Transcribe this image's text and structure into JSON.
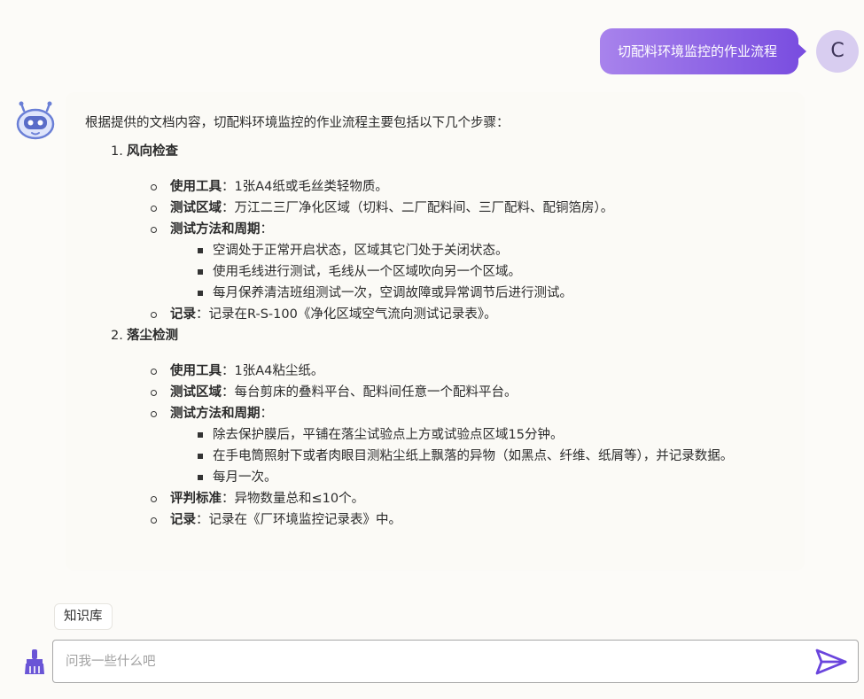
{
  "user_message": {
    "text": "切配料环境监控的作业流程",
    "avatar_letter": "C"
  },
  "bot_message": {
    "intro": "根据提供的文档内容，切配料环境监控的作业流程主要包括以下几个步骤：",
    "steps": [
      {
        "num": "1.",
        "title": "风向检查",
        "items": [
          {
            "key": "使用工具",
            "sep": "：",
            "value": "1张A4纸或毛丝类轻物质。"
          },
          {
            "key": "测试区域",
            "sep": "：",
            "value": "万江二三厂净化区域（切料、二厂配料间、三厂配料、配铜箔房）。"
          },
          {
            "key": "测试方法和周期",
            "sep": "：",
            "value": "",
            "subs": [
              "空调处于正常开启状态，区域其它门处于关闭状态。",
              "使用毛线进行测试，毛线从一个区域吹向另一个区域。",
              "每月保养清洁班组测试一次，空调故障或异常调节后进行测试。"
            ]
          },
          {
            "key": "记录",
            "sep": "：",
            "value": "记录在R-S-100《净化区域空气流向测试记录表》。"
          }
        ]
      },
      {
        "num": "2.",
        "title": "落尘检测",
        "items": [
          {
            "key": "使用工具",
            "sep": "：",
            "value": "1张A4粘尘纸。"
          },
          {
            "key": "测试区域",
            "sep": "：",
            "value": "每台剪床的叠料平台、配料间任意一个配料平台。"
          },
          {
            "key": "测试方法和周期",
            "sep": "：",
            "value": "",
            "subs": [
              "除去保护膜后，平铺在落尘试验点上方或试验点区域15分钟。",
              "在手电筒照射下或者肉眼目测粘尘纸上飘落的异物（如黑点、纤维、纸屑等），并记录数据。",
              "每月一次。"
            ]
          },
          {
            "key": "评判标准",
            "sep": "：",
            "value": "异物数量总和≤10个。"
          },
          {
            "key": "记录",
            "sep": "：",
            "value": "记录在《厂环境监控记录表》中。"
          }
        ]
      }
    ]
  },
  "knowledge_base_tag": "知识库",
  "input": {
    "placeholder": "问我一些什么吧",
    "value": ""
  },
  "icons": {
    "bot": "robot-avatar-icon",
    "broom": "broom-icon",
    "send": "send-icon"
  },
  "colors": {
    "accent": "#7a4ee0",
    "accent_light": "#a883ec",
    "user_avatar_bg": "#d8cdf0"
  }
}
